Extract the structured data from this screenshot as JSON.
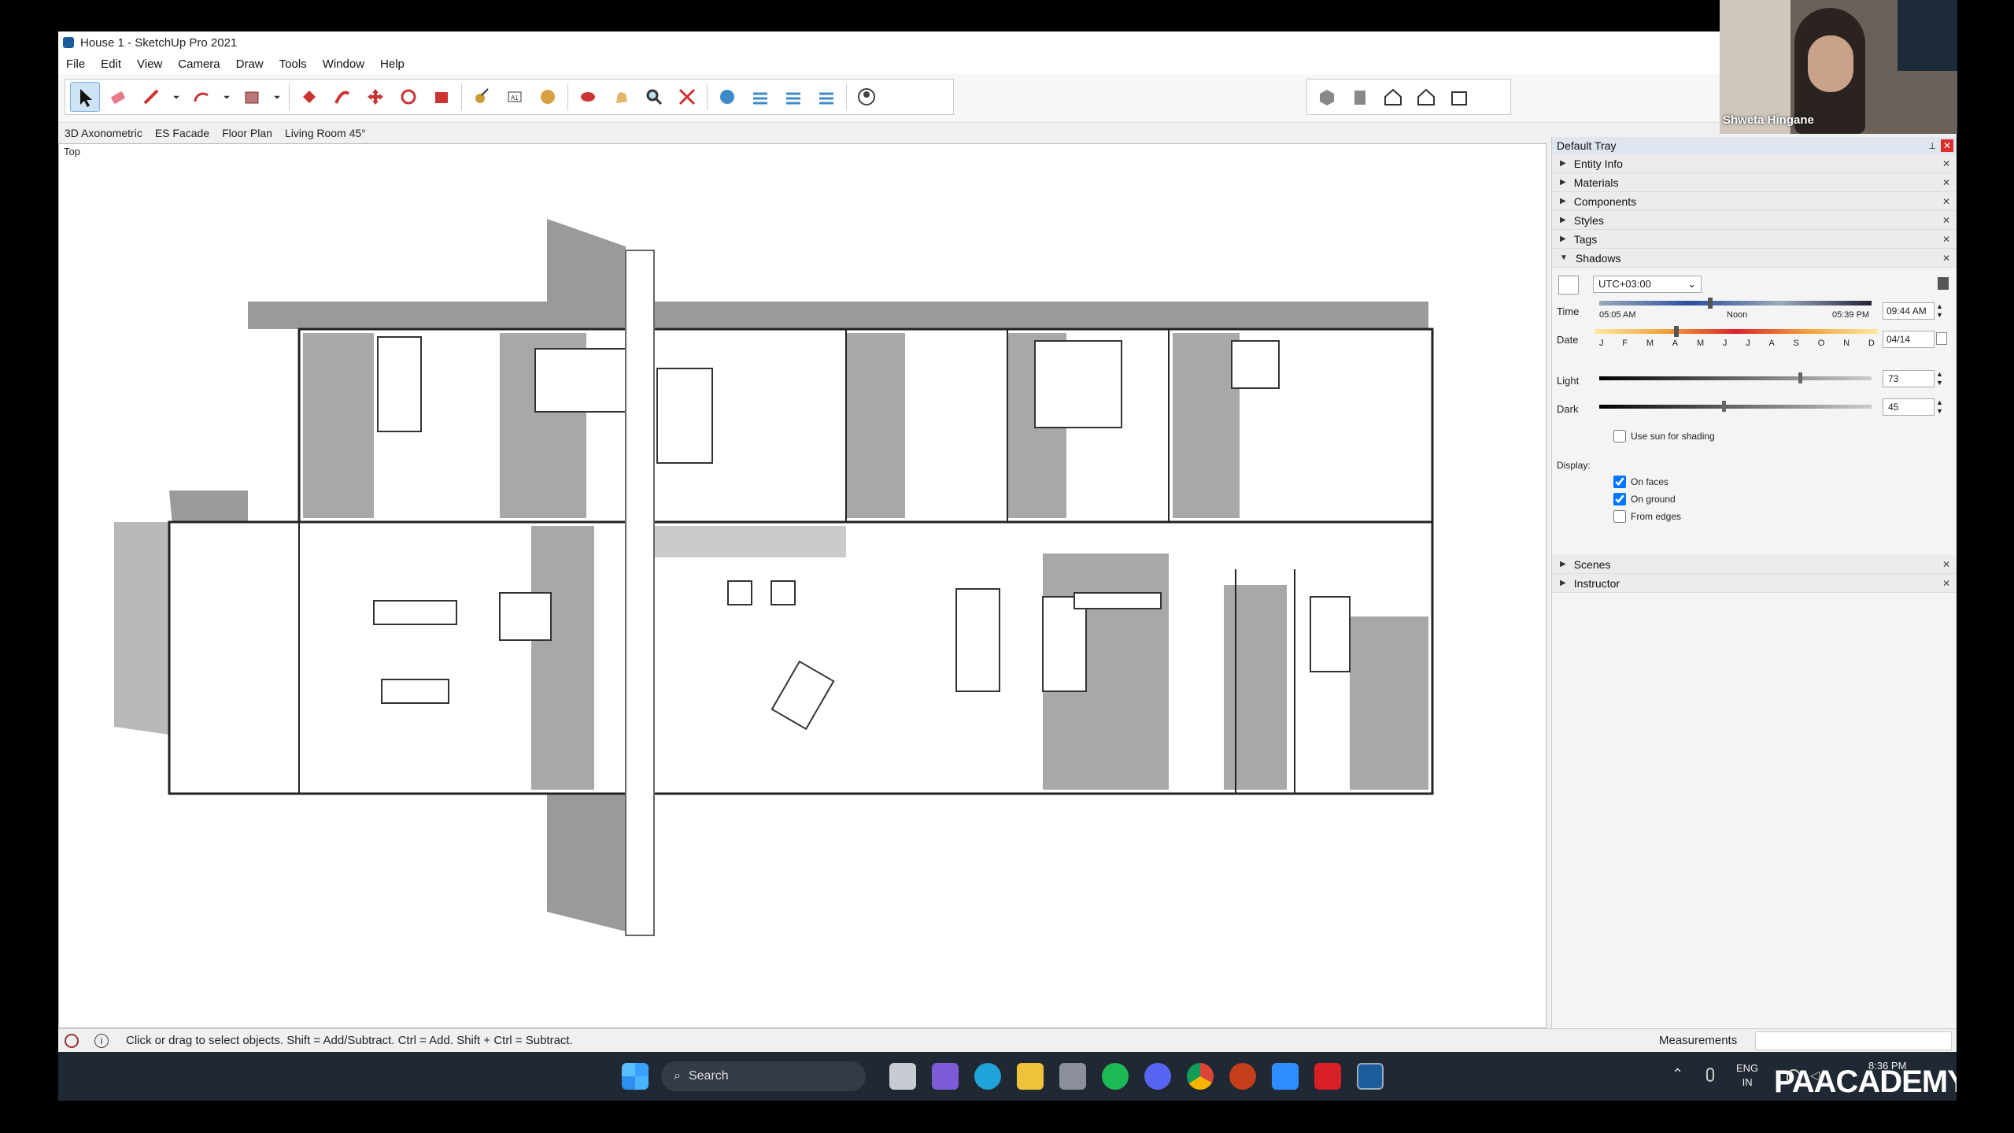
{
  "window": {
    "title": "House 1 - SketchUp Pro 2021"
  },
  "menu": [
    "File",
    "Edit",
    "View",
    "Camera",
    "Draw",
    "Tools",
    "Window",
    "Help"
  ],
  "toolbar_icons": [
    "select-icon",
    "eraser-icon",
    "pencil-icon",
    "dropdown-arrow-icon",
    "arc-icon",
    "dropdown-arrow-icon",
    "rectangle-icon",
    "dropdown-arrow-icon",
    "push-pull-icon",
    "follow-me-icon",
    "move-icon",
    "rotate-icon",
    "scale-icon",
    "tape-measure-icon",
    "text-icon",
    "paint-bucket-icon",
    "orbit-icon",
    "pan-icon",
    "zoom-icon",
    "zoom-extents-icon",
    "section-plane-icon",
    "section-display-icon",
    "section-fill-icon",
    "section-cut-icon",
    "account-icon"
  ],
  "view_icons": [
    "iso-view-icon",
    "front-view-icon",
    "top-view-icon",
    "home-view-icon",
    "back-view-icon"
  ],
  "scene_tabs": [
    "3D Axonometric",
    "ES Facade",
    "Floor Plan",
    "Living Room 45°"
  ],
  "viewport": {
    "camera_label": "Top"
  },
  "tray": {
    "title": "Default Tray",
    "panels_top": [
      "Entity Info",
      "Materials",
      "Components",
      "Styles",
      "Tags"
    ],
    "shadows": {
      "title": "Shadows",
      "timezone": "UTC+03:00",
      "time_label": "Time",
      "time_start": "05:05 AM",
      "time_noon": "Noon",
      "time_end": "05:39 PM",
      "time_value": "09:44 AM",
      "time_fraction": 0.4,
      "date_label": "Date",
      "months": [
        "J",
        "F",
        "M",
        "A",
        "M",
        "J",
        "J",
        "A",
        "S",
        "O",
        "N",
        "D"
      ],
      "date_value": "04/14",
      "date_fraction": 0.28,
      "light_label": "Light",
      "light_value": "73",
      "dark_label": "Dark",
      "dark_value": "45",
      "use_sun_label": "Use sun for shading",
      "display_label": "Display:",
      "on_faces_label": "On faces",
      "on_ground_label": "On ground",
      "from_edges_label": "From edges"
    },
    "panels_bottom": [
      "Scenes",
      "Instructor"
    ]
  },
  "status": {
    "hint": "Click or drag to select objects. Shift = Add/Subtract. Ctrl = Add. Shift + Ctrl = Subtract.",
    "measurements_label": "Measurements"
  },
  "taskbar": {
    "search_placeholder": "Search",
    "lang1": "ENG",
    "lang2": "IN",
    "clock": "8:36 PM"
  },
  "webcam": {
    "participant": "Shweta Hingane"
  },
  "watermark": "PAACADEMY",
  "colors": {
    "accent": "#1c5b9c",
    "tray_close": "#d9302c",
    "taskbar": "#202833"
  }
}
